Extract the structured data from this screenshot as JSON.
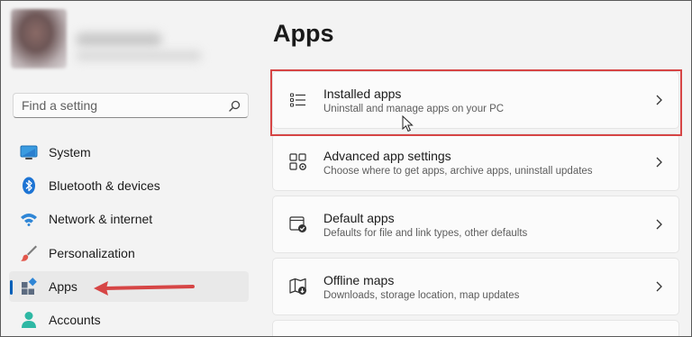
{
  "search": {
    "placeholder": "Find a setting"
  },
  "sidebar": {
    "items": [
      {
        "label": "System",
        "icon": "monitor-icon"
      },
      {
        "label": "Bluetooth & devices",
        "icon": "bluetooth-icon"
      },
      {
        "label": "Network & internet",
        "icon": "wifi-icon"
      },
      {
        "label": "Personalization",
        "icon": "brush-icon"
      },
      {
        "label": "Apps",
        "icon": "apps-icon",
        "selected": true
      },
      {
        "label": "Accounts",
        "icon": "person-icon"
      }
    ]
  },
  "main": {
    "title": "Apps",
    "cards": [
      {
        "title": "Installed apps",
        "subtitle": "Uninstall and manage apps on your PC",
        "icon": "list-icon",
        "highlighted": true
      },
      {
        "title": "Advanced app settings",
        "subtitle": "Choose where to get apps, archive apps, uninstall updates",
        "icon": "app-settings-icon"
      },
      {
        "title": "Default apps",
        "subtitle": "Defaults for file and link types, other defaults",
        "icon": "default-apps-icon"
      },
      {
        "title": "Offline maps",
        "subtitle": "Downloads, storage location, map updates",
        "icon": "map-icon"
      }
    ]
  },
  "colors": {
    "accent": "#005fb8",
    "annotation": "#d64545",
    "background": "#f3f3f3"
  }
}
